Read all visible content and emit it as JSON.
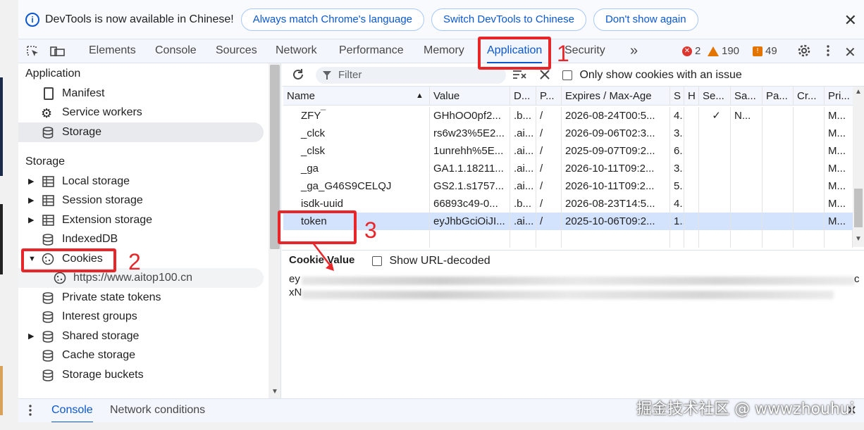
{
  "infobar": {
    "message": "DevTools is now available in Chinese!",
    "btn_match": "Always match Chrome's language",
    "btn_switch": "Switch DevTools to Chinese",
    "btn_dismiss": "Don't show again",
    "close_glyph": "✕"
  },
  "tabs": {
    "elements": "Elements",
    "console": "Console",
    "sources": "Sources",
    "network": "Network",
    "performance": "Performance",
    "memory": "Memory",
    "application": "Application",
    "security": "Security",
    "more": "»",
    "errors": "2",
    "warnings": "190",
    "issues": "49"
  },
  "sidebar": {
    "app_heading": "Application",
    "manifest": "Manifest",
    "service_workers": "Service workers",
    "storage_item": "Storage",
    "storage_heading": "Storage",
    "local_storage": "Local storage",
    "session_storage": "Session storage",
    "extension_storage": "Extension storage",
    "indexeddb": "IndexedDB",
    "cookies": "Cookies",
    "cookie_origin": "https://www.aitop100.cn",
    "private_state_tokens": "Private state tokens",
    "interest_groups": "Interest groups",
    "shared_storage": "Shared storage",
    "cache_storage": "Cache storage",
    "storage_buckets": "Storage buckets"
  },
  "toolbar": {
    "filter_placeholder": "Filter",
    "only_issues_label": "Only show cookies with an issue"
  },
  "table": {
    "headers": [
      "Name",
      "Value",
      "D...",
      "P...",
      "Expires / Max-Age",
      "S",
      "H",
      "Se...",
      "Sa...",
      "Pa...",
      "Cr...",
      "Pri..."
    ],
    "partial_top": "_",
    "rows": [
      [
        "ZFY",
        "GHhOO0pf2...",
        ".b...",
        "/",
        "2026-08-24T00:5...",
        "4...",
        "",
        "✓",
        "N...",
        "",
        "",
        "M..."
      ],
      [
        "_clck",
        "rs6w23%5E2...",
        ".ai...",
        "/",
        "2026-09-06T02:3...",
        "3...",
        "",
        "",
        "",
        "",
        "",
        "M..."
      ],
      [
        "_clsk",
        "1unrehh%5E...",
        ".ai...",
        "/",
        "2025-09-07T09:2...",
        "6...",
        "",
        "",
        "",
        "",
        "",
        "M..."
      ],
      [
        "_ga",
        "GA1.1.18211...",
        ".ai...",
        "/",
        "2026-10-11T09:2...",
        "3...",
        "",
        "",
        "",
        "",
        "",
        "M..."
      ],
      [
        "_ga_G46S9CELQJ",
        "GS2.1.s1757...",
        ".ai...",
        "/",
        "2026-10-11T09:2...",
        "5...",
        "",
        "",
        "",
        "",
        "",
        "M..."
      ],
      [
        "isdk-uuid",
        "66893c49-0...",
        ".b...",
        "/",
        "2026-08-23T14:5...",
        "4...",
        "",
        "",
        "",
        "",
        "",
        "M..."
      ],
      [
        "token",
        "eyJhbGciOiJI...",
        ".ai...",
        "/",
        "2025-10-06T09:2...",
        "1...",
        "",
        "",
        "",
        "",
        "",
        "M..."
      ]
    ]
  },
  "cookie_value": {
    "title": "Cookie Value",
    "show_decoded": "Show URL-decoded",
    "line1_start": "ey",
    "line1_end": "c",
    "line2_start": "xN"
  },
  "drawer": {
    "console": "Console",
    "network_conditions": "Network conditions"
  },
  "annotations": {
    "n1": "1",
    "n2": "2",
    "n3": "3",
    "color": "#e8262a"
  },
  "watermark": "掘金技术社区 @ wwwzhouhui"
}
